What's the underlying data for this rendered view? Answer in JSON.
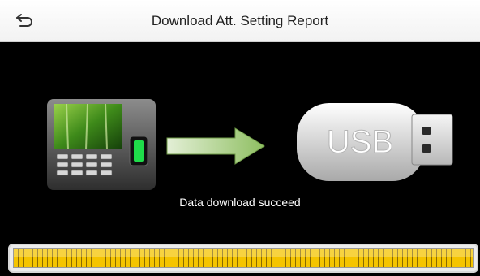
{
  "header": {
    "title": "Download Att. Setting Report",
    "back_icon": "back-arrow-icon"
  },
  "illustration": {
    "device_icon": "attendance-terminal-icon",
    "arrow_icon": "right-arrow-icon",
    "usb_icon": "usb-drive-icon",
    "usb_label": "USB"
  },
  "status": {
    "message": "Data download succeed"
  },
  "progress": {
    "percent": 100,
    "color": "#f5c400"
  }
}
